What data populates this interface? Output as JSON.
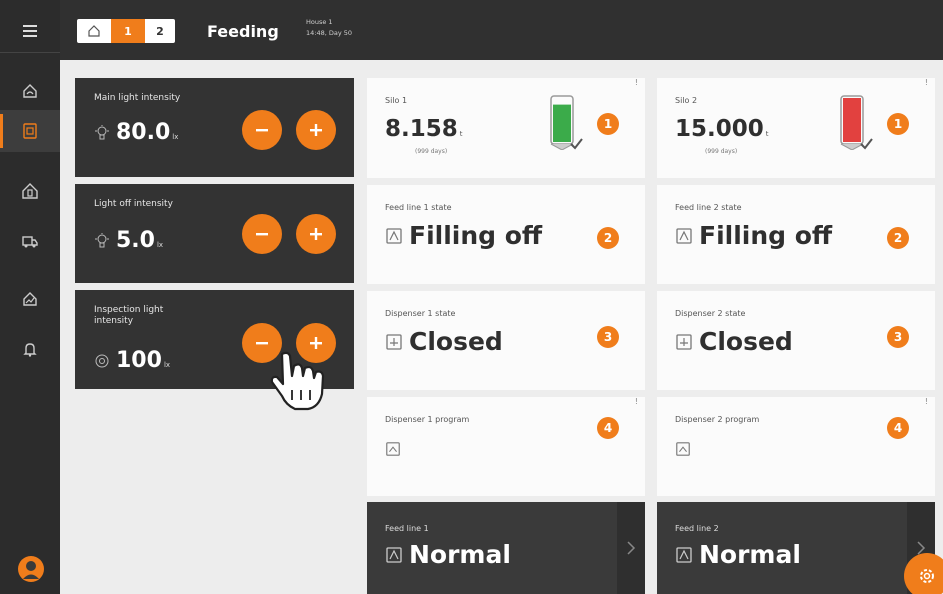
{
  "header": {
    "house_tabs": {
      "home_icon": "home-icon",
      "tab1": "1",
      "tab2": "2"
    },
    "title": "Feeding",
    "house_name": "House 1",
    "time_day": "14:48, Day 50"
  },
  "sidebar": {
    "items": [
      {
        "icon": "menu-icon"
      },
      {
        "icon": "dashboard-icon"
      },
      {
        "icon": "control-icon",
        "active": true
      },
      {
        "icon": "house-icon"
      },
      {
        "icon": "truck-icon"
      },
      {
        "icon": "analytics-icon"
      },
      {
        "icon": "bell-icon"
      },
      {
        "icon": "user-avatar"
      }
    ]
  },
  "lights": [
    {
      "label": "Main light intensity",
      "value": "80.0",
      "unit": "lx",
      "icon": "bulb-icon"
    },
    {
      "label": "Light off intensity",
      "value": "5.0",
      "unit": "lx",
      "icon": "bulb-icon"
    },
    {
      "label": "Inspection light intensity",
      "value": "100",
      "unit": "lx",
      "icon": "inspection-icon"
    }
  ],
  "silos": [
    {
      "label": "Silo 1",
      "value": "8.158",
      "unit": "t",
      "days": "(999 days)",
      "badge": "1",
      "level_color": "#3bab4a",
      "fill_fraction": 0.85
    },
    {
      "label": "Silo 2",
      "value": "15.000",
      "unit": "t",
      "days": "(999 days)",
      "badge": "1",
      "level_color": "#e2413f",
      "fill_fraction": 1.0
    }
  ],
  "feed_line_states": [
    {
      "label": "Feed line 1 state",
      "value": "Filling off",
      "badge": "2"
    },
    {
      "label": "Feed line 2 state",
      "value": "Filling off",
      "badge": "2"
    }
  ],
  "dispenser_states": [
    {
      "label": "Dispenser 1 state",
      "value": "Closed",
      "badge": "3"
    },
    {
      "label": "Dispenser 2 state",
      "value": "Closed",
      "badge": "3"
    }
  ],
  "dispenser_programs": [
    {
      "label": "Dispenser 1 program",
      "value": "",
      "badge": "4"
    },
    {
      "label": "Dispenser 2 program",
      "value": "",
      "badge": "4"
    }
  ],
  "feed_lines": [
    {
      "label": "Feed line 1",
      "value": "Normal"
    },
    {
      "label": "Feed line 2",
      "value": "Normal"
    }
  ],
  "warning_mark": "!",
  "colors": {
    "accent": "#f07d1b",
    "dark": "#303030",
    "card_dark": "#333333",
    "background": "#ededed"
  }
}
